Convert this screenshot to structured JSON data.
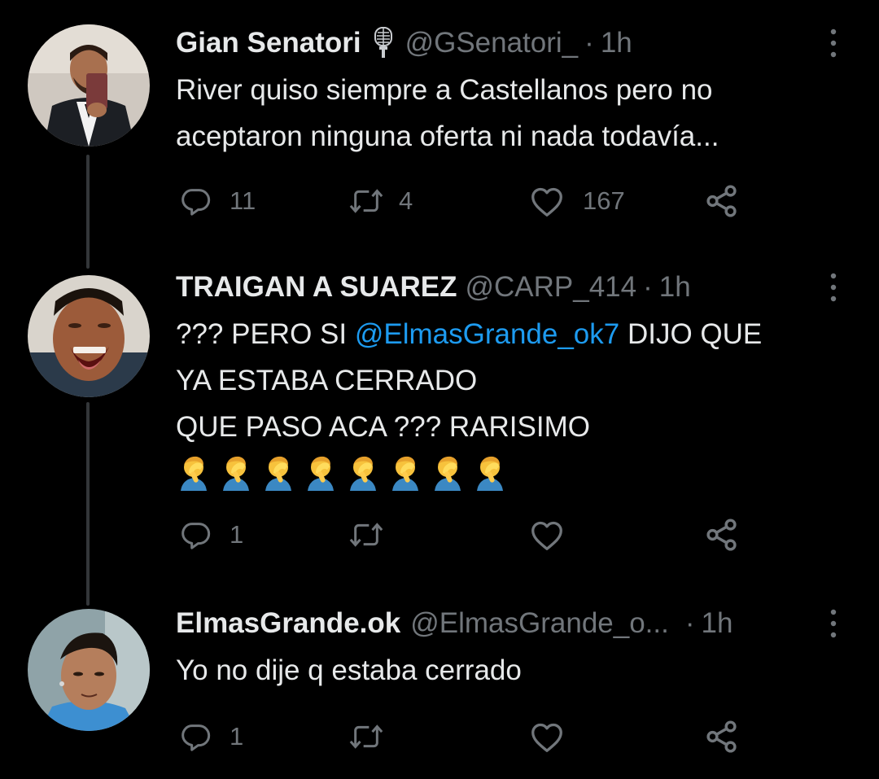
{
  "colors": {
    "background": "#000000",
    "text_primary": "#e7e9ea",
    "text_secondary": "#71767b",
    "mention": "#1d9bf0",
    "thread_line": "#333639"
  },
  "tweets": [
    {
      "display_name": "Gian Senatori",
      "badge_icon": "microphone-icon",
      "handle": "@GSenatori_",
      "separator": "·",
      "time": "1h",
      "text_lines": [
        "River quiso siempre a Castellanos pero no",
        "aceptaron ninguna oferta ni nada todavía..."
      ],
      "actions": {
        "reply_count": "11",
        "retweet_count": "4",
        "like_count": "167"
      }
    },
    {
      "display_name": "TRAIGAN A SUAREZ",
      "handle": "@CARP_414",
      "separator": "·",
      "time": "1h",
      "line1_prefix": "??? PERO SI ",
      "mention": "@ElmasGrande_ok7",
      "line1_suffix": " DIJO QUE",
      "text_lines": [
        "YA ESTABA CERRADO",
        "QUE PASO ACA ??? RARISIMO"
      ],
      "emoji": "🤦‍♂️",
      "emoji_count": 8,
      "actions": {
        "reply_count": "1",
        "retweet_count": "",
        "like_count": ""
      }
    },
    {
      "display_name": "ElmasGrande.ok",
      "handle": "@ElmasGrande_o...",
      "separator": "·",
      "time": "1h",
      "text_lines": [
        "Yo no dije q estaba cerrado"
      ],
      "actions": {
        "reply_count": "1",
        "retweet_count": "",
        "like_count": ""
      }
    }
  ]
}
